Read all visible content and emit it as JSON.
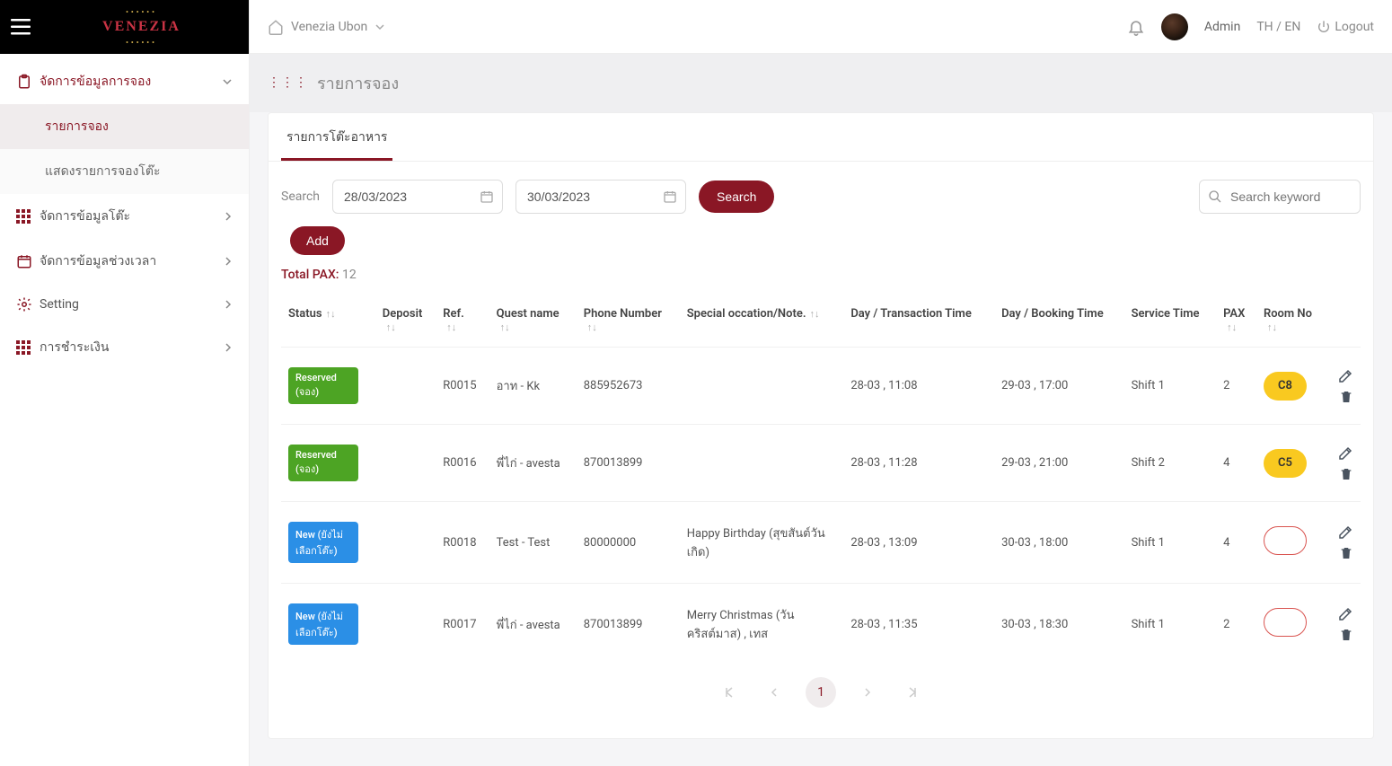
{
  "logo": {
    "top": "",
    "main": "VENEZIA",
    "bottom": ""
  },
  "header": {
    "location": "Venezia Ubon",
    "admin_label": "Admin",
    "lang": "TH / EN",
    "logout": "Logout"
  },
  "sidebar": {
    "items": [
      {
        "label": "จัดการข้อมูลการจอง",
        "active": true,
        "expanded": true
      },
      {
        "label": "จัดการข้อมูลโต๊ะ"
      },
      {
        "label": "จัดการข้อมูลช่วงเวลา"
      },
      {
        "label": "Setting"
      },
      {
        "label": "การชำระเงิน"
      }
    ],
    "sub": [
      {
        "label": "รายการจอง",
        "active": true
      },
      {
        "label": "แสดงรายการจองโต๊ะ"
      }
    ]
  },
  "page": {
    "title": "รายการจอง",
    "tab": "รายการโต๊ะอาหาร",
    "search_label": "Search",
    "date_from": "28/03/2023",
    "date_to": "30/03/2023",
    "search_btn": "Search",
    "keyword_placeholder": "Search keyword",
    "add_btn": "Add",
    "total_pax_label": "Total PAX:",
    "total_pax_value": "12"
  },
  "columns": {
    "status": "Status",
    "deposit": "Deposit",
    "ref": "Ref.",
    "guest": "Quest name",
    "phone": "Phone Number",
    "note": "Special occation/Note.",
    "trx_time": "Day / Transaction Time",
    "book_time": "Day / Booking Time",
    "service": "Service Time",
    "pax": "PAX",
    "room": "Room No"
  },
  "rows": [
    {
      "status_text": "Reserved (จอง)",
      "status_kind": "reserved",
      "deposit": "",
      "ref": "R0015",
      "guest": "อาท - Kk",
      "phone": "885952673",
      "note": "",
      "trx": "28-03 , 11:08",
      "book": "29-03 , 17:00",
      "service": "Shift 1",
      "pax": "2",
      "room": "C8",
      "room_kind": "yellow"
    },
    {
      "status_text": "Reserved (จอง)",
      "status_kind": "reserved",
      "deposit": "",
      "ref": "R0016",
      "guest": "พี่ไก่ - avesta",
      "phone": "870013899",
      "note": "",
      "trx": "28-03 , 11:28",
      "book": "29-03 , 21:00",
      "service": "Shift 2",
      "pax": "4",
      "room": "C5",
      "room_kind": "yellow"
    },
    {
      "status_text": "New (ยังไม่เลือกโต๊ะ)",
      "status_kind": "new",
      "deposit": "",
      "ref": "R0018",
      "guest": "Test - Test",
      "phone": "80000000",
      "note": "Happy Birthday (สุขสันต์วันเกิด)",
      "trx": "28-03 , 13:09",
      "book": "30-03 , 18:00",
      "service": "Shift 1",
      "pax": "4",
      "room": "",
      "room_kind": "empty"
    },
    {
      "status_text": "New (ยังไม่เลือกโต๊ะ)",
      "status_kind": "new",
      "deposit": "",
      "ref": "R0017",
      "guest": "พี่ไก่ - avesta",
      "phone": "870013899",
      "note": "Merry Christmas (วันคริสต์มาส) , เทส",
      "trx": "28-03 , 11:35",
      "book": "30-03 , 18:30",
      "service": "Shift 1",
      "pax": "2",
      "room": "",
      "room_kind": "empty"
    }
  ],
  "pagination": {
    "current": "1"
  }
}
